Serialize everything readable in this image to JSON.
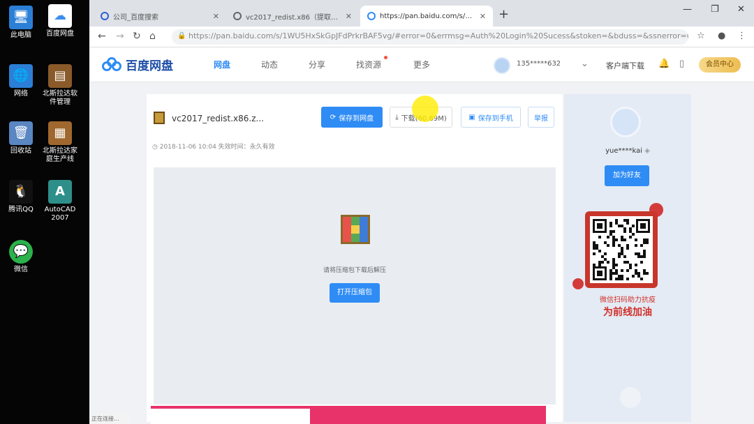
{
  "desktop": {
    "icons": [
      {
        "label": "此电脑",
        "icon": "computer-icon",
        "color": "#2b7fd6"
      },
      {
        "label": "百度网盘",
        "icon": "baidu-netdisk-icon",
        "color": "#3b8cf0"
      },
      {
        "label": "网络",
        "icon": "network-icon",
        "color": "#2b7fd6"
      },
      {
        "label": "北斯拉达软\n件管理",
        "icon": "software-manager-icon",
        "color": "#8a5a2a"
      },
      {
        "label": "回收站",
        "icon": "recycle-bin-icon",
        "color": "#5a86c2"
      },
      {
        "label": "北斯拉达家\n庭生产线",
        "icon": "production-line-icon",
        "color": "#a0682e"
      },
      {
        "label": "腾讯QQ",
        "icon": "qq-icon",
        "color": "#e8e8e8"
      },
      {
        "label": "AutoCAD\n2007",
        "icon": "autocad-icon",
        "color": "#2e8f8a"
      },
      {
        "label": "微信",
        "icon": "wechat-icon",
        "color": "#2bb24c"
      }
    ]
  },
  "browser": {
    "tabs": [
      {
        "label": "公司_百度搜索"
      },
      {
        "label": "vc2017_redist.x86（提取码：...）"
      },
      {
        "label": "https://pan.baidu.com/s/1WU..."
      }
    ],
    "url": "https://pan.baidu.com/s/1WU5HxSkGpJFdPrkrBAF5vg/#error=0&errmsg=Auth%20Login%20Sucess&stoken=&bduss=&ssnerror=0&traceid=",
    "win_minimize": "—",
    "win_restore": "❐",
    "win_close": "✕"
  },
  "header": {
    "logo_text": "百度网盘",
    "nav": [
      "网盘",
      "动态",
      "分享",
      "找资源",
      "更多"
    ],
    "username": "135*****632",
    "client_download": "客户端下载",
    "vip_label": "会员中心"
  },
  "file": {
    "name": "vc2017_redist.x86.z...",
    "buttons": {
      "save": "保存到网盘",
      "download": "下载(60.69M)",
      "phone": "保存到手机",
      "report": "举报"
    },
    "meta": "2018-11-06 10:04   失效时间：永久有效",
    "preview_name": "请将压缩包下载后解压",
    "open_label": "打开压缩包"
  },
  "sidebar": {
    "sharer_name": "yue****kai",
    "follow_label": "加为好友",
    "qr_caption1": "微信扫码助力抗疫",
    "qr_caption2": "为前线加油"
  },
  "statusbar": {
    "text": "正在连接..."
  }
}
